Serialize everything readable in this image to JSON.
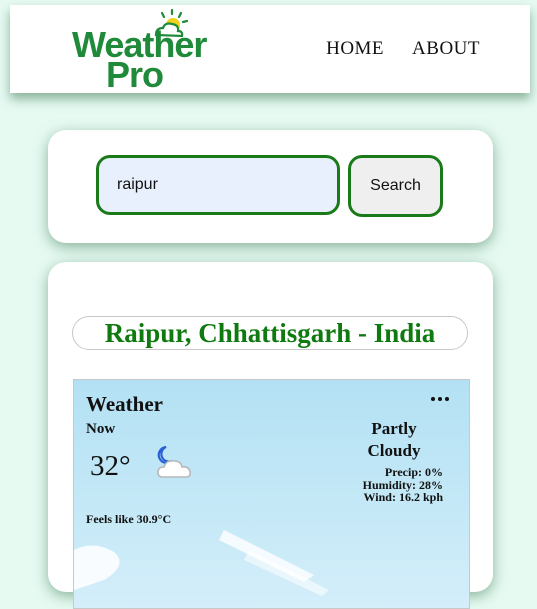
{
  "header": {
    "logo": {
      "line1": "Weather",
      "line2": "Pro"
    },
    "nav": [
      {
        "label": "HOME"
      },
      {
        "label": "ABOUT"
      }
    ]
  },
  "search": {
    "value": "raipur",
    "button_label": "Search"
  },
  "result": {
    "location": "Raipur, Chhattisgarh - India",
    "widget": {
      "title": "Weather",
      "now_label": "Now",
      "temperature": "32°",
      "condition_line1": "Partly",
      "condition_line2": "Cloudy",
      "icon": "moon-cloud-icon",
      "precip": "Precip: 0%",
      "humidity": "Humidity: 28%",
      "wind": "Wind: 16.2 kph",
      "feels_like": "Feels like 30.9°C"
    }
  },
  "colors": {
    "brand_green": "#1f8a3a",
    "border_green": "#1a7a1a",
    "location_green": "#0f7a0f",
    "page_bg": "#e6faf2",
    "widget_sky": "#b3e1f4"
  }
}
